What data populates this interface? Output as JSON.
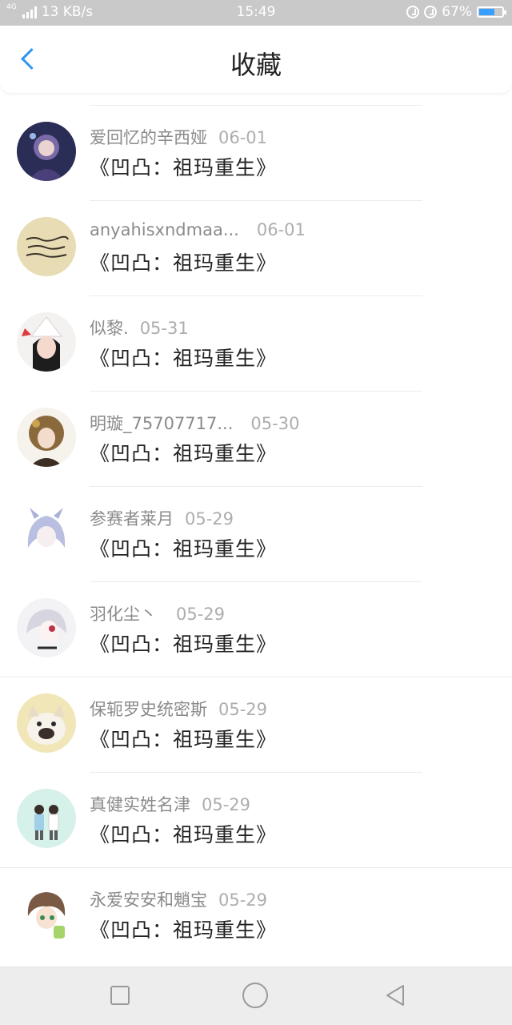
{
  "status_bar": {
    "network": "4G",
    "speed": "13 KB/s",
    "time": "15:49",
    "battery": "67%",
    "battery_level": 0.67
  },
  "header": {
    "title": "收藏"
  },
  "items": [
    {
      "user": "爱回忆的辛西娅",
      "date": "06-01",
      "title": "《凹凸：祖玛重生》"
    },
    {
      "user": "anyahisxndmaa...",
      "date": "06-01",
      "title": "《凹凸：祖玛重生》"
    },
    {
      "user": "似黎.",
      "date": "05-31",
      "title": "《凹凸：祖玛重生》"
    },
    {
      "user": "明璇_75707717...",
      "date": "05-30",
      "title": "《凹凸：祖玛重生》"
    },
    {
      "user": "参赛者莱月",
      "date": "05-29",
      "title": "《凹凸：祖玛重生》"
    },
    {
      "user": "羽化尘丶",
      "date": "05-29",
      "title": "《凹凸：祖玛重生》"
    },
    {
      "user": "保轭罗史统密斯",
      "date": "05-29",
      "title": "《凹凸：祖玛重生》"
    },
    {
      "user": "真健实姓名津",
      "date": "05-29",
      "title": "《凹凸：祖玛重生》"
    },
    {
      "user": "永爱安安和魈宝",
      "date": "05-29",
      "title": "《凹凸：祖玛重生》"
    }
  ],
  "colors": {
    "accent": "#2c95f0",
    "status_bar": "#c9c9c9"
  }
}
